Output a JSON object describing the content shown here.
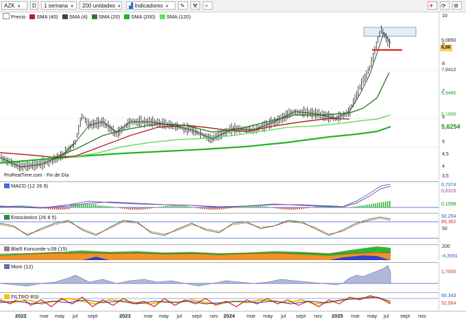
{
  "toolbar": {
    "symbol": "AZK",
    "period_mode": "D",
    "timeframe": "1 semana",
    "units": "200 unidades",
    "indicators": "Indicadores"
  },
  "price_legend": [
    {
      "label": "Precio",
      "color": "#ffffff"
    },
    {
      "label": "SMA (40)",
      "color": "#b22222"
    },
    {
      "label": "SMA (4)",
      "color": "#2f4f1f"
    },
    {
      "label": "SMA (20)",
      "color": "#2d7a2d"
    },
    {
      "label": "SMA (200)",
      "color": "#1fb51f"
    },
    {
      "label": "SMA (120)",
      "color": "#66e066"
    }
  ],
  "price_axis": {
    "ticks": [
      "10",
      "9",
      "8",
      "7",
      "6",
      "5",
      "4,5",
      "4",
      "3,5"
    ],
    "tags": [
      {
        "value": "9,0850",
        "bg": "#ffffff",
        "color": "#222"
      },
      {
        "value": "8,86",
        "bg": "#f5d35a",
        "color": "#000"
      },
      {
        "value": "7,8410",
        "bg": "#ffffff",
        "color": "#2f4f1f"
      },
      {
        "value": "6,9480",
        "bg": "#ffffff",
        "color": "#2d9a2d"
      },
      {
        "value": "6,1896",
        "bg": "#ffffff",
        "color": "#2dbb2d"
      },
      {
        "value": "5,6254",
        "bg": "#ffffff",
        "color": "#1a8a1a"
      }
    ]
  },
  "source_note": "ProRealTime.com - Fin de Día",
  "indicators": {
    "macd": {
      "label": "MACD (12 26 9)",
      "tags": [
        "0,7374",
        "0,6316",
        "0,1058"
      ]
    },
    "stoch": {
      "label": "Estocástico (26 8 5)",
      "tags": [
        "92,254",
        "89,362"
      ],
      "ticks": [
        "50"
      ]
    },
    "blai5": {
      "label": "Blai5 Koncorde v.09 (15)",
      "tags": [
        "-4,3591"
      ],
      "ticks": [
        "200"
      ]
    },
    "mom": {
      "label": "Mom (12)",
      "tags": [
        "1,7000"
      ]
    },
    "rsi": {
      "label": "FILTRO RSI",
      "tags": [
        "60,343",
        "52,564"
      ]
    }
  },
  "x_axis": {
    "labels": [
      "2022",
      "mar",
      "may",
      "jul",
      "sept",
      "2023",
      "mar",
      "may",
      "jul",
      "sept",
      "nov",
      "2024",
      "mar",
      "may",
      "jul",
      "sept",
      "nov",
      "2025",
      "mar",
      "may",
      "jul",
      "sept",
      "nov"
    ]
  }
}
